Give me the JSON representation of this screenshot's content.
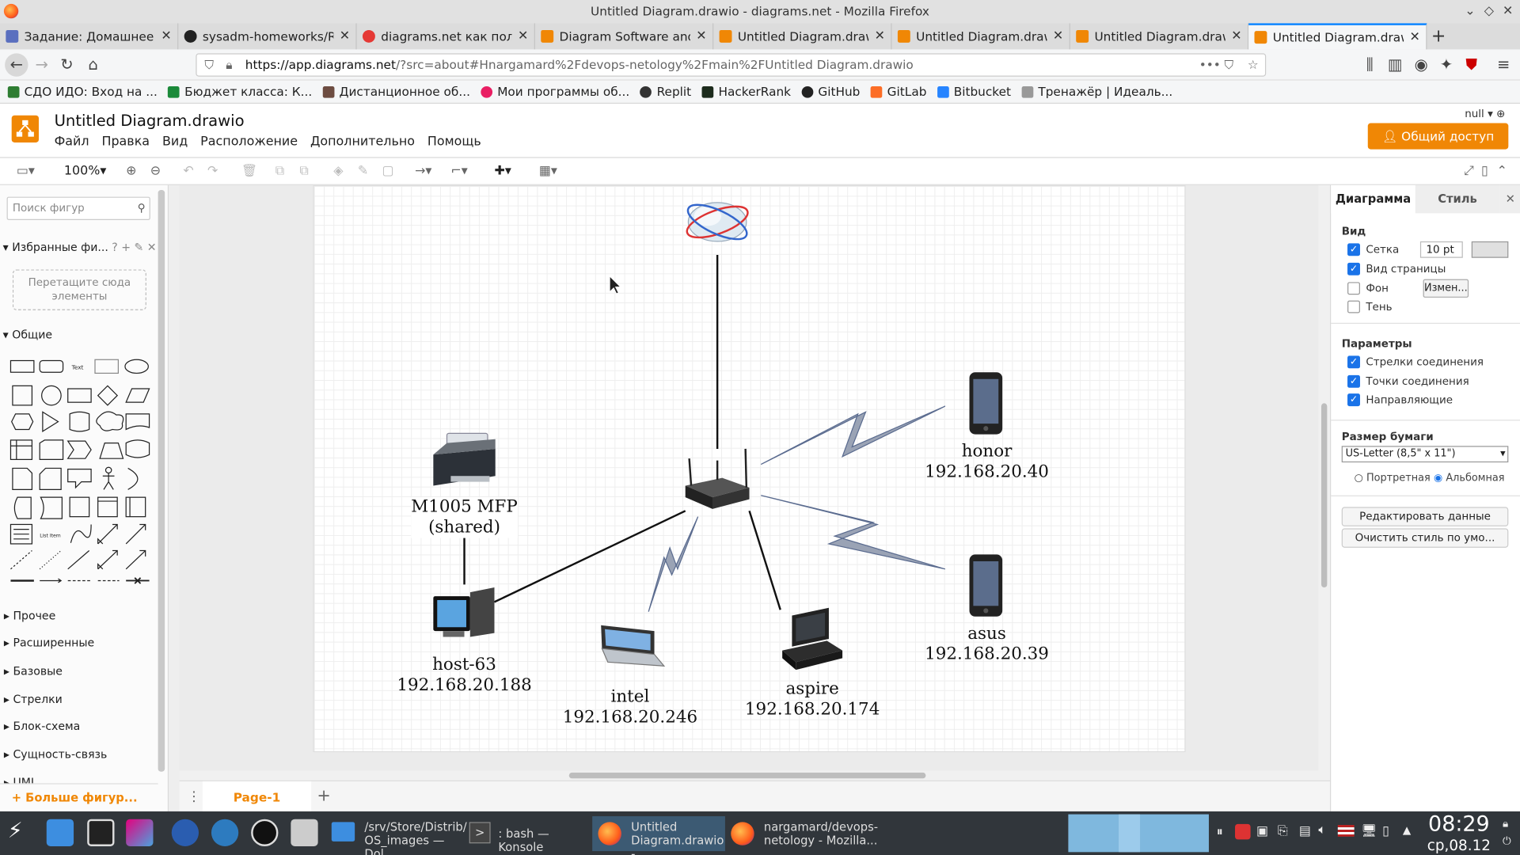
{
  "window": {
    "title": "Untitled Diagram.drawio - diagrams.net - Mozilla Firefox"
  },
  "tabs": [
    {
      "label": "Задание: Домашнее за",
      "color": "#5a6fbf"
    },
    {
      "label": "sysadm-homeworks/REA",
      "color": "#222222"
    },
    {
      "label": "diagrams.net как польз",
      "color": "#e53935"
    },
    {
      "label": "Diagram Software and Fl",
      "color": "#f08705"
    },
    {
      "label": "Untitled Diagram.drawio",
      "color": "#f08705"
    },
    {
      "label": "Untitled Diagram.drawio",
      "color": "#f08705"
    },
    {
      "label": "Untitled Diagram.drawio",
      "color": "#f08705"
    },
    {
      "label": "Untitled Diagram.drawio",
      "color": "#f08705"
    }
  ],
  "url": {
    "host": "https://app.diagrams.net",
    "path": "/?src=about#Hnargamard%2Fdevops-netology%2Fmain%2FUntitled Diagram.drawio"
  },
  "bookmarks": [
    {
      "label": "СДО ИДО: Вход на ...",
      "color": "#2e7d32"
    },
    {
      "label": "Бюджет класса: К...",
      "color": "#1b8a3a"
    },
    {
      "label": "Дистанционное об...",
      "color": "#6d4c41"
    },
    {
      "label": "Мои программы об...",
      "color": "#e91e63"
    },
    {
      "label": "Replit",
      "color": "#333333"
    },
    {
      "label": "HackerRank",
      "color": "#1c2b1c"
    },
    {
      "label": "GitHub",
      "color": "#222222"
    },
    {
      "label": "GitLab",
      "color": "#fc6d26"
    },
    {
      "label": "Bitbucket",
      "color": "#2684ff"
    },
    {
      "label": "Тренажёр | Идеаль...",
      "color": "#999999"
    }
  ],
  "app": {
    "doc_title": "Untitled Diagram.drawio",
    "menus": [
      "Файл",
      "Правка",
      "Вид",
      "Расположение",
      "Дополнительно",
      "Помощь"
    ],
    "share_label": "Общий доступ",
    "user": "null"
  },
  "toolbar": {
    "zoom": "100%"
  },
  "left": {
    "search_placeholder": "Поиск фигур",
    "favorites": "Избранные фи...",
    "drop_hint": "Перетащите сюда элементы",
    "general": "Общие",
    "categories": [
      "Прочее",
      "Расширенные",
      "Базовые",
      "Стрелки",
      "Блок-схема",
      "Сущность-связь",
      "UML"
    ],
    "more_shapes": "Больше фигур..."
  },
  "diagram": {
    "printer": {
      "name": "M1005 MFP",
      "sub": "(shared)"
    },
    "host63": {
      "name": "host-63",
      "ip": "192.168.20.188"
    },
    "intel": {
      "name": "intel",
      "ip": "192.168.20.246"
    },
    "aspire": {
      "name": "aspire",
      "ip": "192.168.20.174"
    },
    "honor": {
      "name": "honor",
      "ip": "192.168.20.40"
    },
    "asus": {
      "name": "asus",
      "ip": "192.168.20.39"
    }
  },
  "page_tab": "Page-1",
  "right": {
    "tab_diagram": "Диаграмма",
    "tab_style": "Стиль",
    "view_heading": "Вид",
    "grid": "Сетка",
    "grid_size": "10 pt",
    "page_view": "Вид страницы",
    "background": "Фон",
    "change_btn": "Измен...",
    "shadow": "Тень",
    "params_heading": "Параметры",
    "arrows": "Стрелки соединения",
    "points": "Точки соединения",
    "guides": "Направляющие",
    "paper_heading": "Размер бумаги",
    "paper_size": "US-Letter (8,5\" x 11\")",
    "portrait": "Портретная",
    "landscape": "Альбомная",
    "edit_data": "Редактировать данные",
    "clear_style": "Очистить стиль по умо..."
  },
  "taskbar": {
    "task1_line1": "/srv/Store/Distrib/",
    "task1_line2": "OS_images — Dol...",
    "task2": ": bash — Konsole",
    "task3_line1": "Untitled",
    "task3_line2": "Diagram.drawio - ...",
    "task4_line1": "nargamard/devops-",
    "task4_line2": "netology - Mozilla...",
    "time": "08:29",
    "date": "ср,08.12"
  }
}
